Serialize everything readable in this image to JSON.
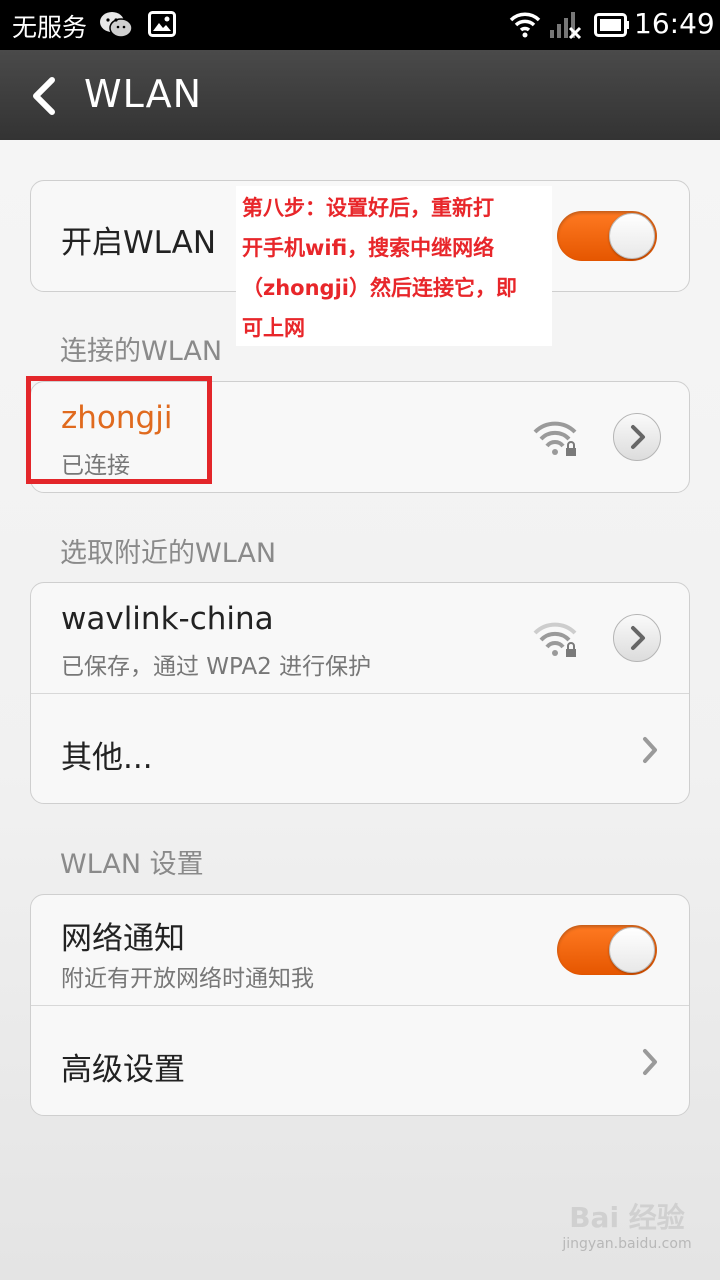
{
  "status_bar": {
    "carrier": "无服务",
    "time": "16:49",
    "icons": [
      "wechat-icon",
      "gallery-icon",
      "wifi-icon",
      "signal-none-icon",
      "battery-icon"
    ]
  },
  "header": {
    "title": "WLAN"
  },
  "wlan_toggle": {
    "label": "开启WLAN",
    "on": true
  },
  "annotation": {
    "lines": [
      "第八步：设置好后，重新打",
      "开手机wifi，搜索中继网络",
      "（zhongji）然后连接它，即",
      "可上网"
    ]
  },
  "connected_section": {
    "label": "连接的WLAN",
    "network": {
      "ssid": "zhongji",
      "status": "已连接"
    }
  },
  "nearby_section": {
    "label": "选取附近的WLAN",
    "network": {
      "ssid": "wavlink-china",
      "status": "已保存，通过 WPA2 进行保护"
    },
    "other_label": "其他..."
  },
  "settings_section": {
    "label": "WLAN 设置",
    "notify": {
      "title": "网络通知",
      "subtitle": "附近有开放网络时通知我",
      "on": true
    },
    "advanced_label": "高级设置"
  },
  "watermark": {
    "main": "Bai 经验",
    "url": "jingyan.baidu.com"
  },
  "colors": {
    "accent": "#ff6a10",
    "annotation": "#e8262a",
    "connected": "#e06a1e"
  }
}
